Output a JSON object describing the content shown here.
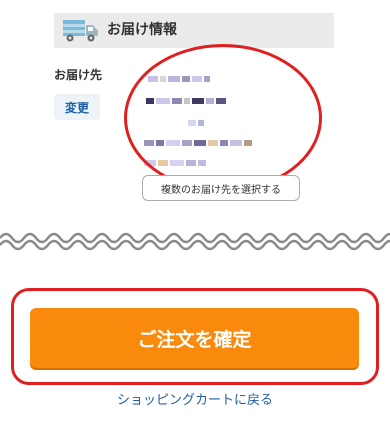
{
  "section": {
    "title": "お届け情報",
    "icon": "delivery-truck-icon"
  },
  "destination": {
    "label": "お届け先",
    "change_button": "変更",
    "multi_select_button": "複数のお届け先を選択する"
  },
  "order": {
    "confirm_button": "ご注文を確定",
    "back_link": "ショッピングカートに戻る"
  },
  "colors": {
    "accent": "#fa8a0c",
    "link": "#1f5fa6",
    "highlight": "#e02020",
    "header_bg": "#ebebeb"
  }
}
